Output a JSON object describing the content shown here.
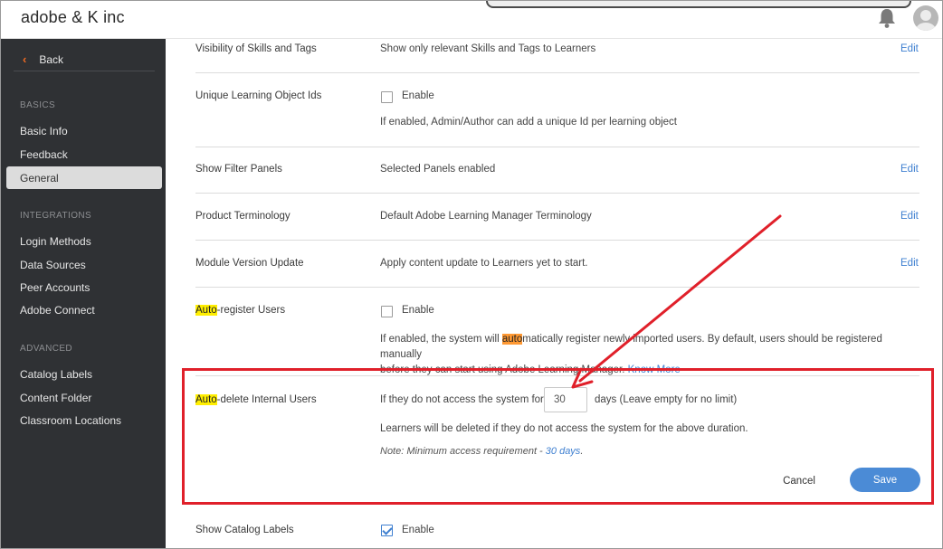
{
  "header": {
    "app_title": "adobe & K inc"
  },
  "sidebar": {
    "back_label": "Back",
    "sections": {
      "basics": "BASICS",
      "integrations": "INTEGRATIONS",
      "advanced": "ADVANCED"
    },
    "items": [
      {
        "label": "Basic Info"
      },
      {
        "label": "Feedback"
      },
      {
        "label": "General"
      },
      {
        "label": "Login Methods"
      },
      {
        "label": "Data Sources"
      },
      {
        "label": "Peer Accounts"
      },
      {
        "label": "Adobe Connect"
      },
      {
        "label": "Catalog Labels"
      },
      {
        "label": "Content Folder"
      },
      {
        "label": "Classroom Locations"
      }
    ]
  },
  "settings": {
    "edit_label": "Edit",
    "enable_label": "Enable",
    "visibility": {
      "label": "Visibility of Skills and Tags",
      "value": "Show only relevant Skills and Tags to Learners"
    },
    "unique_ids": {
      "label": "Unique Learning Object Ids",
      "desc": "If enabled, Admin/Author can add a unique Id per learning object"
    },
    "filter_panels": {
      "label": "Show Filter Panels",
      "value": "Selected Panels enabled"
    },
    "terminology": {
      "label": "Product Terminology",
      "value": "Default Adobe Learning Manager Terminology"
    },
    "module_version": {
      "label": "Module Version Update",
      "value": "Apply content update to Learners yet to start."
    },
    "auto_register": {
      "label_hl": "Auto",
      "label_rest": "-register Users",
      "desc_pre": "If enabled, the system will ",
      "desc_hl": "auto",
      "desc_post": "matically register newly imported users. By default, users should be registered manually",
      "desc_line2": "before they can start using Adobe Learning Manager.",
      "know_more": "Know More"
    },
    "auto_delete": {
      "label_hl": "Auto",
      "label_rest": "-delete Internal Users",
      "prefix": "If they do not access the system for",
      "days_value": "30",
      "suffix": "days (Leave empty for no limit)",
      "desc": "Learners will be deleted if they do not access the system for the above duration.",
      "note_pre": "Note: Minimum access requirement - ",
      "note_link": "30 days",
      "note_post": ".",
      "cancel_label": "Cancel",
      "save_label": "Save"
    },
    "catalog_labels": {
      "label": "Show Catalog Labels"
    }
  },
  "colors": {
    "annotation": "#e0202a",
    "accent": "#3e7fd0",
    "highlight": "#ffee00",
    "highlight_orange": "#ff9933"
  }
}
